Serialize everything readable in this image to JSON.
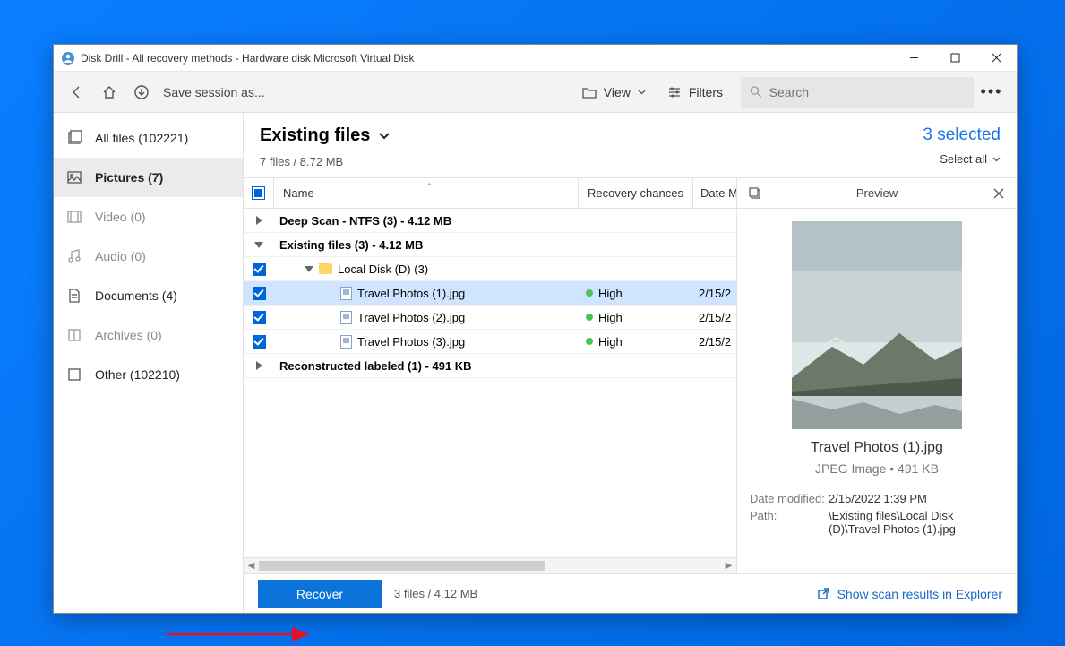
{
  "window": {
    "title": "Disk Drill - All recovery methods - Hardware disk Microsoft Virtual Disk"
  },
  "toolbar": {
    "save_session_label": "Save session as...",
    "view_label": "View",
    "filters_label": "Filters",
    "search_placeholder": "Search"
  },
  "sidebar": {
    "items": [
      {
        "label": "All files (102221)"
      },
      {
        "label": "Pictures (7)"
      },
      {
        "label": "Video (0)"
      },
      {
        "label": "Audio (0)"
      },
      {
        "label": "Documents (4)"
      },
      {
        "label": "Archives (0)"
      },
      {
        "label": "Other (102210)"
      }
    ]
  },
  "main": {
    "title": "Existing files",
    "subtitle": "7 files / 8.72 MB",
    "selected_text": "3 selected",
    "select_all_label": "Select all"
  },
  "columns": {
    "name": "Name",
    "chance": "Recovery chances",
    "date": "Date M"
  },
  "rows": {
    "deep_scan": "Deep Scan - NTFS (3) - 4.12 MB",
    "existing": "Existing files (3) - 4.12 MB",
    "local_disk": "Local Disk (D) (3)",
    "f1": {
      "name": "Travel Photos (1).jpg",
      "chance": "High",
      "date": "2/15/2"
    },
    "f2": {
      "name": "Travel Photos (2).jpg",
      "chance": "High",
      "date": "2/15/2"
    },
    "f3": {
      "name": "Travel Photos (3).jpg",
      "chance": "High",
      "date": "2/15/2"
    },
    "reconstructed": "Reconstructed labeled (1) - 491 KB"
  },
  "preview": {
    "header": "Preview",
    "filename": "Travel Photos (1).jpg",
    "meta": "JPEG Image • 491 KB",
    "date_modified_label": "Date modified:",
    "date_modified_value": "2/15/2022 1:39 PM",
    "path_label": "Path:",
    "path_value": "\\Existing files\\Local Disk (D)\\Travel Photos (1).jpg"
  },
  "footer": {
    "recover_label": "Recover",
    "status": "3 files / 4.12 MB",
    "explorer_label": "Show scan results in Explorer"
  }
}
